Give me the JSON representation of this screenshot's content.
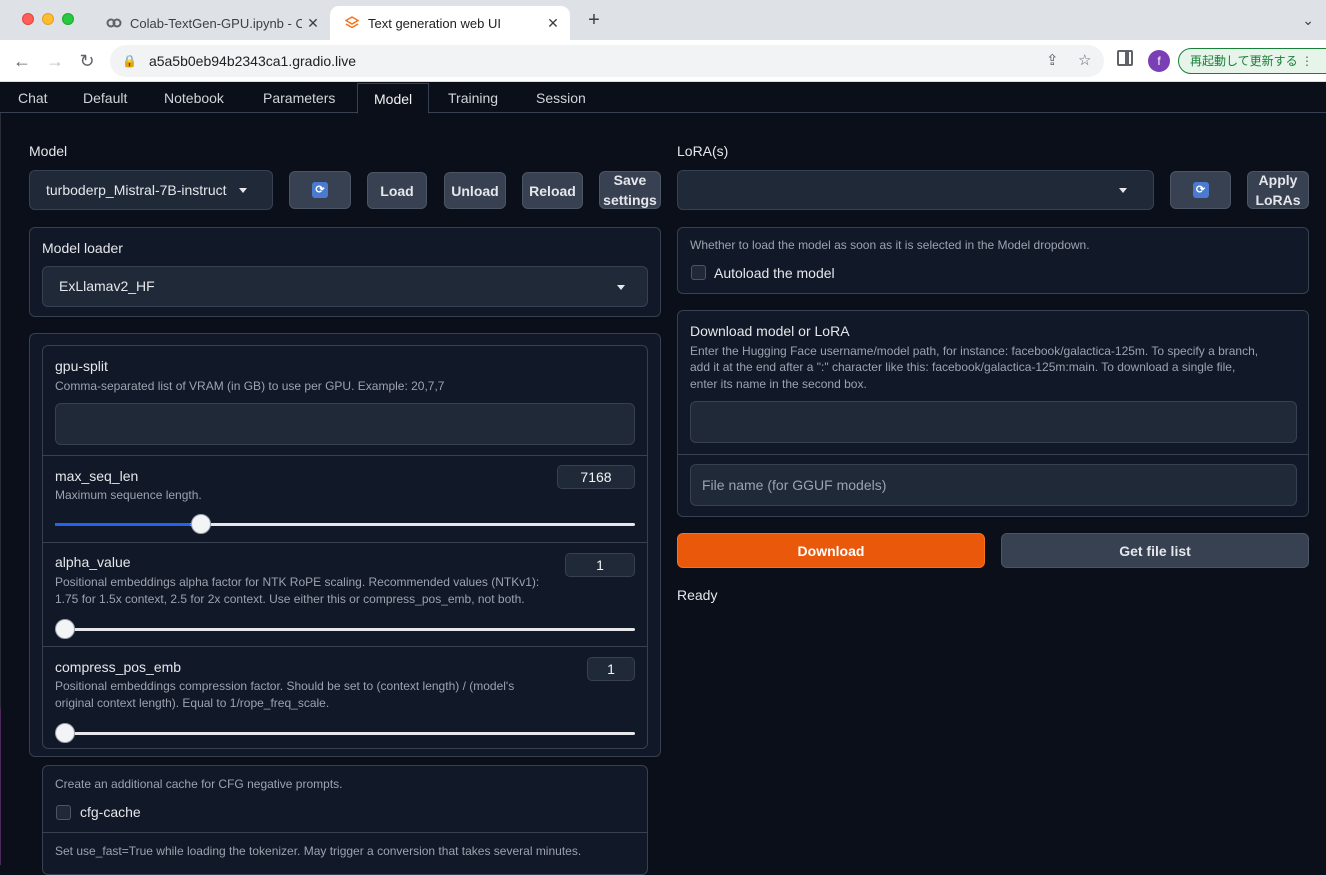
{
  "browser": {
    "tabs": [
      {
        "title": "Colab-TextGen-GPU.ipynb - C",
        "favicon": "colab-icon",
        "active": false
      },
      {
        "title": "Text generation web UI",
        "favicon": "gradio-icon",
        "active": true
      }
    ],
    "new_tab": "+",
    "close_glyph": "✕",
    "url": "a5a5b0eb94b2343ca1.gradio.live",
    "profile_initial": "f",
    "update_button": "再起動して更新する"
  },
  "app_tabs": [
    "Chat",
    "Default",
    "Notebook",
    "Parameters",
    "Model",
    "Training",
    "Session"
  ],
  "active_app_tab": "Model",
  "model": {
    "label": "Model",
    "selected": "turboderp_Mistral-7B-instruct",
    "refresh_icon": "refresh-icon",
    "buttons": {
      "load": "Load",
      "unload": "Unload",
      "reload": "Reload",
      "save_1": "Save",
      "save_2": "settings"
    }
  },
  "loader": {
    "label": "Model loader",
    "selected": "ExLlamav2_HF"
  },
  "params": {
    "gpu_split": {
      "label": "gpu-split",
      "info": "Comma-separated list of VRAM (in GB) to use per GPU. Example: 20,7,7",
      "value": ""
    },
    "max_seq_len": {
      "label": "max_seq_len",
      "info": "Maximum sequence length.",
      "value": "7168",
      "slider_fraction": 0.234
    },
    "alpha_value": {
      "label": "alpha_value",
      "info_1": "Positional embeddings alpha factor for NTK RoPE scaling. Recommended values (NTKv1):",
      "info_2": "1.75 for 1.5x context, 2.5 for 2x context. Use either this or compress_pos_emb, not both.",
      "value": "1",
      "slider_fraction": 0.0
    },
    "compress_pos_emb": {
      "label": "compress_pos_emb",
      "info_1": "Positional embeddings compression factor. Should be set to (context length) / (model's",
      "info_2": "original context length). Equal to 1/rope_freq_scale.",
      "value": "1",
      "slider_fraction": 0.0
    }
  },
  "cfg": {
    "info": "Create an additional cache for CFG negative prompts.",
    "label": "cfg-cache",
    "checked": false
  },
  "use_fast": {
    "info": "Set use_fast=True while loading the tokenizer. May trigger a conversion that takes several minutes."
  },
  "lora": {
    "label": "LoRA(s)",
    "selected": "",
    "apply_1": "Apply",
    "apply_2": "LoRAs"
  },
  "autoload": {
    "info": "Whether to load the model as soon as it is selected in the Model dropdown.",
    "label": "Autoload the model",
    "checked": false
  },
  "download": {
    "title": "Download model or LoRA",
    "info_1": "Enter the Hugging Face username/model path, for instance: facebook/galactica-125m. To specify a branch,",
    "info_2": "add it at the end after a \":\" character like this: facebook/galactica-125m:main. To download a single file,",
    "info_3": "enter its name in the second box.",
    "path_value": "",
    "file_placeholder": "File name (for GGUF models)",
    "download_button": "Download",
    "get_list_button": "Get file list",
    "status": "Ready"
  },
  "colors": {
    "accent": "#ea580c",
    "slider": "#2563eb",
    "background": "#0b0f19"
  }
}
